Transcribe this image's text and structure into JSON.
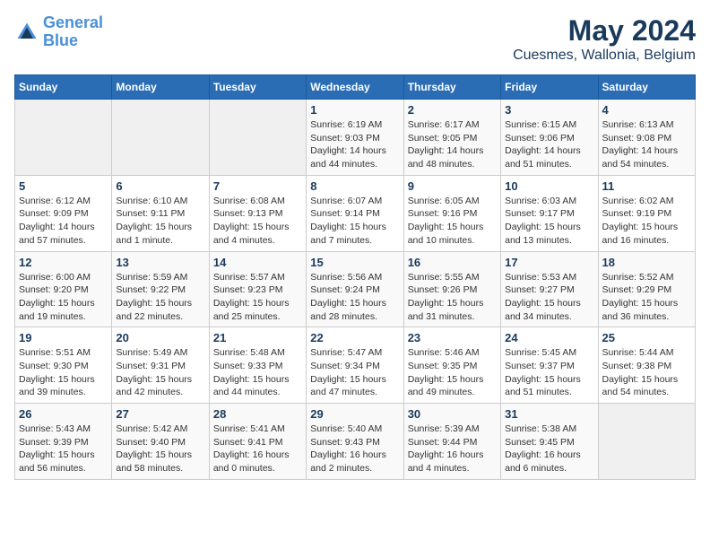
{
  "header": {
    "logo_line1": "General",
    "logo_line2": "Blue",
    "title": "May 2024",
    "subtitle": "Cuesmes, Wallonia, Belgium"
  },
  "weekdays": [
    "Sunday",
    "Monday",
    "Tuesday",
    "Wednesday",
    "Thursday",
    "Friday",
    "Saturday"
  ],
  "weeks": [
    [
      {
        "day": "",
        "info": ""
      },
      {
        "day": "",
        "info": ""
      },
      {
        "day": "",
        "info": ""
      },
      {
        "day": "1",
        "info": "Sunrise: 6:19 AM\nSunset: 9:03 PM\nDaylight: 14 hours\nand 44 minutes."
      },
      {
        "day": "2",
        "info": "Sunrise: 6:17 AM\nSunset: 9:05 PM\nDaylight: 14 hours\nand 48 minutes."
      },
      {
        "day": "3",
        "info": "Sunrise: 6:15 AM\nSunset: 9:06 PM\nDaylight: 14 hours\nand 51 minutes."
      },
      {
        "day": "4",
        "info": "Sunrise: 6:13 AM\nSunset: 9:08 PM\nDaylight: 14 hours\nand 54 minutes."
      }
    ],
    [
      {
        "day": "5",
        "info": "Sunrise: 6:12 AM\nSunset: 9:09 PM\nDaylight: 14 hours\nand 57 minutes."
      },
      {
        "day": "6",
        "info": "Sunrise: 6:10 AM\nSunset: 9:11 PM\nDaylight: 15 hours\nand 1 minute."
      },
      {
        "day": "7",
        "info": "Sunrise: 6:08 AM\nSunset: 9:13 PM\nDaylight: 15 hours\nand 4 minutes."
      },
      {
        "day": "8",
        "info": "Sunrise: 6:07 AM\nSunset: 9:14 PM\nDaylight: 15 hours\nand 7 minutes."
      },
      {
        "day": "9",
        "info": "Sunrise: 6:05 AM\nSunset: 9:16 PM\nDaylight: 15 hours\nand 10 minutes."
      },
      {
        "day": "10",
        "info": "Sunrise: 6:03 AM\nSunset: 9:17 PM\nDaylight: 15 hours\nand 13 minutes."
      },
      {
        "day": "11",
        "info": "Sunrise: 6:02 AM\nSunset: 9:19 PM\nDaylight: 15 hours\nand 16 minutes."
      }
    ],
    [
      {
        "day": "12",
        "info": "Sunrise: 6:00 AM\nSunset: 9:20 PM\nDaylight: 15 hours\nand 19 minutes."
      },
      {
        "day": "13",
        "info": "Sunrise: 5:59 AM\nSunset: 9:22 PM\nDaylight: 15 hours\nand 22 minutes."
      },
      {
        "day": "14",
        "info": "Sunrise: 5:57 AM\nSunset: 9:23 PM\nDaylight: 15 hours\nand 25 minutes."
      },
      {
        "day": "15",
        "info": "Sunrise: 5:56 AM\nSunset: 9:24 PM\nDaylight: 15 hours\nand 28 minutes."
      },
      {
        "day": "16",
        "info": "Sunrise: 5:55 AM\nSunset: 9:26 PM\nDaylight: 15 hours\nand 31 minutes."
      },
      {
        "day": "17",
        "info": "Sunrise: 5:53 AM\nSunset: 9:27 PM\nDaylight: 15 hours\nand 34 minutes."
      },
      {
        "day": "18",
        "info": "Sunrise: 5:52 AM\nSunset: 9:29 PM\nDaylight: 15 hours\nand 36 minutes."
      }
    ],
    [
      {
        "day": "19",
        "info": "Sunrise: 5:51 AM\nSunset: 9:30 PM\nDaylight: 15 hours\nand 39 minutes."
      },
      {
        "day": "20",
        "info": "Sunrise: 5:49 AM\nSunset: 9:31 PM\nDaylight: 15 hours\nand 42 minutes."
      },
      {
        "day": "21",
        "info": "Sunrise: 5:48 AM\nSunset: 9:33 PM\nDaylight: 15 hours\nand 44 minutes."
      },
      {
        "day": "22",
        "info": "Sunrise: 5:47 AM\nSunset: 9:34 PM\nDaylight: 15 hours\nand 47 minutes."
      },
      {
        "day": "23",
        "info": "Sunrise: 5:46 AM\nSunset: 9:35 PM\nDaylight: 15 hours\nand 49 minutes."
      },
      {
        "day": "24",
        "info": "Sunrise: 5:45 AM\nSunset: 9:37 PM\nDaylight: 15 hours\nand 51 minutes."
      },
      {
        "day": "25",
        "info": "Sunrise: 5:44 AM\nSunset: 9:38 PM\nDaylight: 15 hours\nand 54 minutes."
      }
    ],
    [
      {
        "day": "26",
        "info": "Sunrise: 5:43 AM\nSunset: 9:39 PM\nDaylight: 15 hours\nand 56 minutes."
      },
      {
        "day": "27",
        "info": "Sunrise: 5:42 AM\nSunset: 9:40 PM\nDaylight: 15 hours\nand 58 minutes."
      },
      {
        "day": "28",
        "info": "Sunrise: 5:41 AM\nSunset: 9:41 PM\nDaylight: 16 hours\nand 0 minutes."
      },
      {
        "day": "29",
        "info": "Sunrise: 5:40 AM\nSunset: 9:43 PM\nDaylight: 16 hours\nand 2 minutes."
      },
      {
        "day": "30",
        "info": "Sunrise: 5:39 AM\nSunset: 9:44 PM\nDaylight: 16 hours\nand 4 minutes."
      },
      {
        "day": "31",
        "info": "Sunrise: 5:38 AM\nSunset: 9:45 PM\nDaylight: 16 hours\nand 6 minutes."
      },
      {
        "day": "",
        "info": ""
      }
    ]
  ]
}
